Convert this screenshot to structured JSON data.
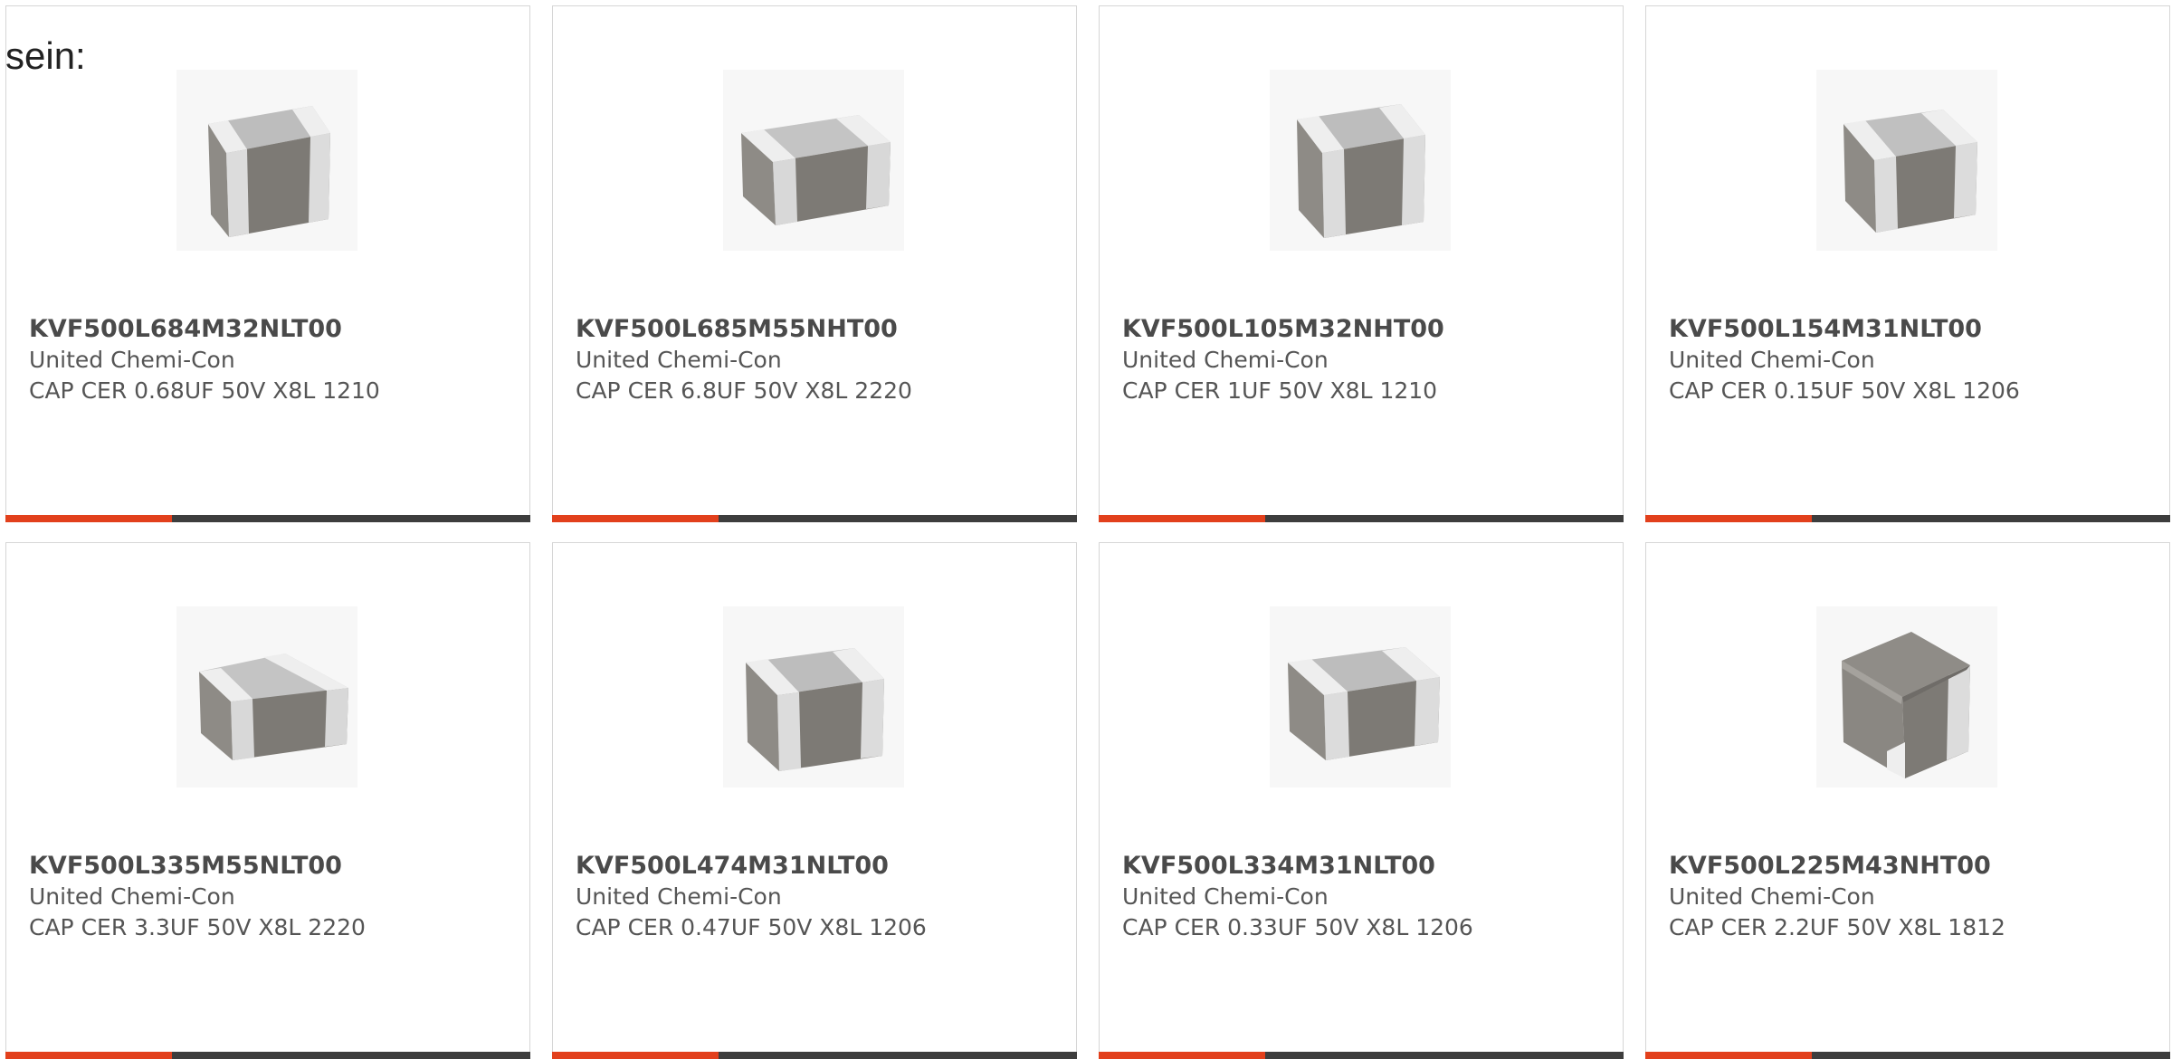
{
  "intro_text": "sein:",
  "colors": {
    "accent": "#e2401c",
    "bar": "#3d3d3d",
    "border": "#d6d6d6"
  },
  "products": [
    {
      "part": "KVF500L684M32NLT00",
      "manufacturer": "United Chemi-Con",
      "description": "CAP CER 0.68UF 50V X8L 1210",
      "image_icon": "capacitor-chip-icon"
    },
    {
      "part": "KVF500L685M55NHT00",
      "manufacturer": "United Chemi-Con",
      "description": "CAP CER 6.8UF 50V X8L 2220",
      "image_icon": "capacitor-chip-icon"
    },
    {
      "part": "KVF500L105M32NHT00",
      "manufacturer": "United Chemi-Con",
      "description": "CAP CER 1UF 50V X8L 1210",
      "image_icon": "capacitor-chip-icon"
    },
    {
      "part": "KVF500L154M31NLT00",
      "manufacturer": "United Chemi-Con",
      "description": "CAP CER 0.15UF 50V X8L 1206",
      "image_icon": "capacitor-chip-icon"
    },
    {
      "part": "KVF500L335M55NLT00",
      "manufacturer": "United Chemi-Con",
      "description": "CAP CER 3.3UF 50V X8L 2220",
      "image_icon": "capacitor-chip-icon"
    },
    {
      "part": "KVF500L474M31NLT00",
      "manufacturer": "United Chemi-Con",
      "description": "CAP CER 0.47UF 50V X8L 1206",
      "image_icon": "capacitor-chip-icon"
    },
    {
      "part": "KVF500L334M31NLT00",
      "manufacturer": "United Chemi-Con",
      "description": "CAP CER 0.33UF 50V X8L 1206",
      "image_icon": "capacitor-chip-icon"
    },
    {
      "part": "KVF500L225M43NHT00",
      "manufacturer": "United Chemi-Con",
      "description": "CAP CER 2.2UF 50V X8L 1812",
      "image_icon": "capacitor-chip-icon"
    }
  ]
}
